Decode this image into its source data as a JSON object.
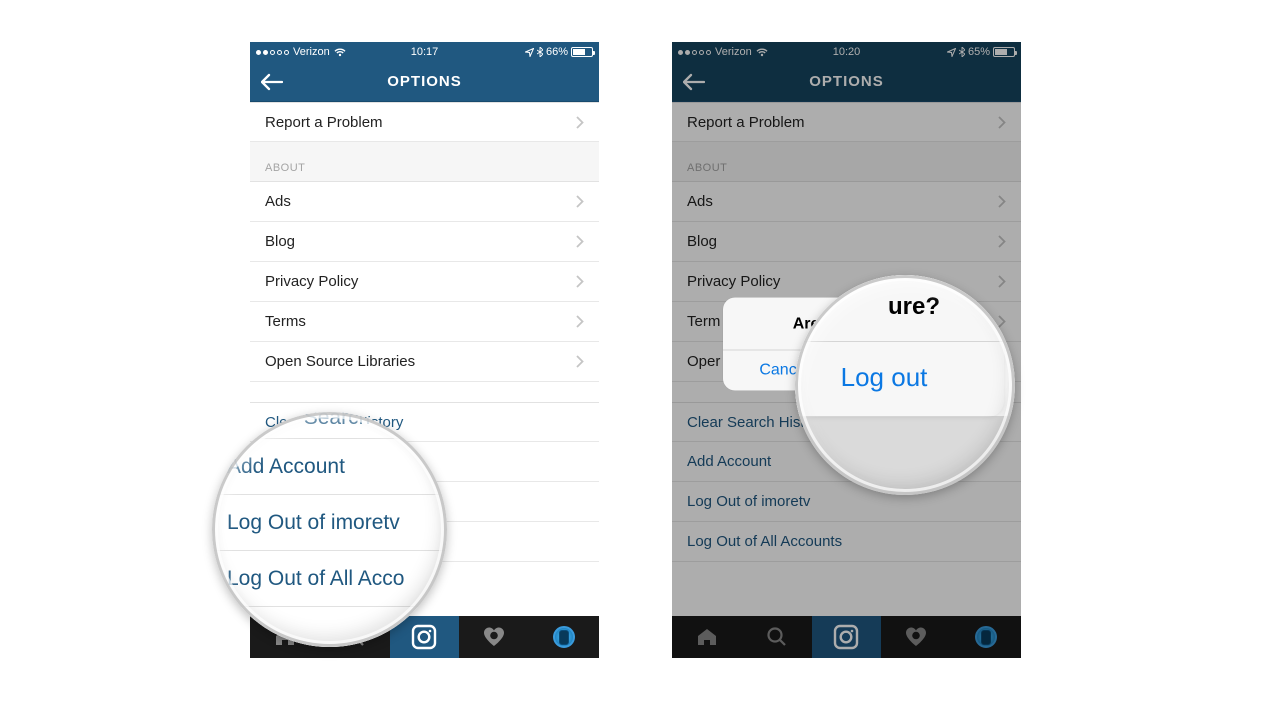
{
  "phone1": {
    "status": {
      "carrier": "Verizon",
      "time": "10:17",
      "battery_pct": "66%",
      "signal_filled": 2
    },
    "nav": {
      "title": "OPTIONS"
    },
    "rows": {
      "report": "Report a Problem",
      "about_header": "ABOUT",
      "ads": "Ads",
      "blog": "Blog",
      "privacy": "Privacy Policy",
      "terms": "Terms",
      "osl": "Open Source Libraries",
      "clear": "Clear Search History",
      "add_account": "Add Account",
      "logout_user": "Log Out of imoretv",
      "logout_all": "Log Out of All Accounts"
    },
    "magnifier": {
      "partial_word": "Search",
      "add_account": "Add Account",
      "logout_user": "Log Out of imoretv",
      "logout_all": "Log Out of All Acco"
    }
  },
  "phone2": {
    "status": {
      "carrier": "Verizon",
      "time": "10:20",
      "battery_pct": "65%",
      "signal_filled": 2
    },
    "nav": {
      "title": "OPTIONS"
    },
    "rows": {
      "report": "Report a Problem",
      "about_header": "ABOUT",
      "ads": "Ads",
      "blog": "Blog",
      "privacy": "Privacy Policy",
      "terms": "Terms",
      "osl": "Open Source Libraries",
      "clear": "Clear Search History",
      "add_account": "Add Account",
      "logout_user": "Log Out of imoretv",
      "logout_all": "Log Out of All Accounts"
    },
    "terms_truncated": "Term",
    "osl_truncated": "Oper",
    "alert": {
      "title": "Are you sure?",
      "cancel": "Cancel",
      "confirm": "Log out"
    },
    "magnifier": {
      "title_fragment": "ure?",
      "btn": "Log out"
    }
  }
}
